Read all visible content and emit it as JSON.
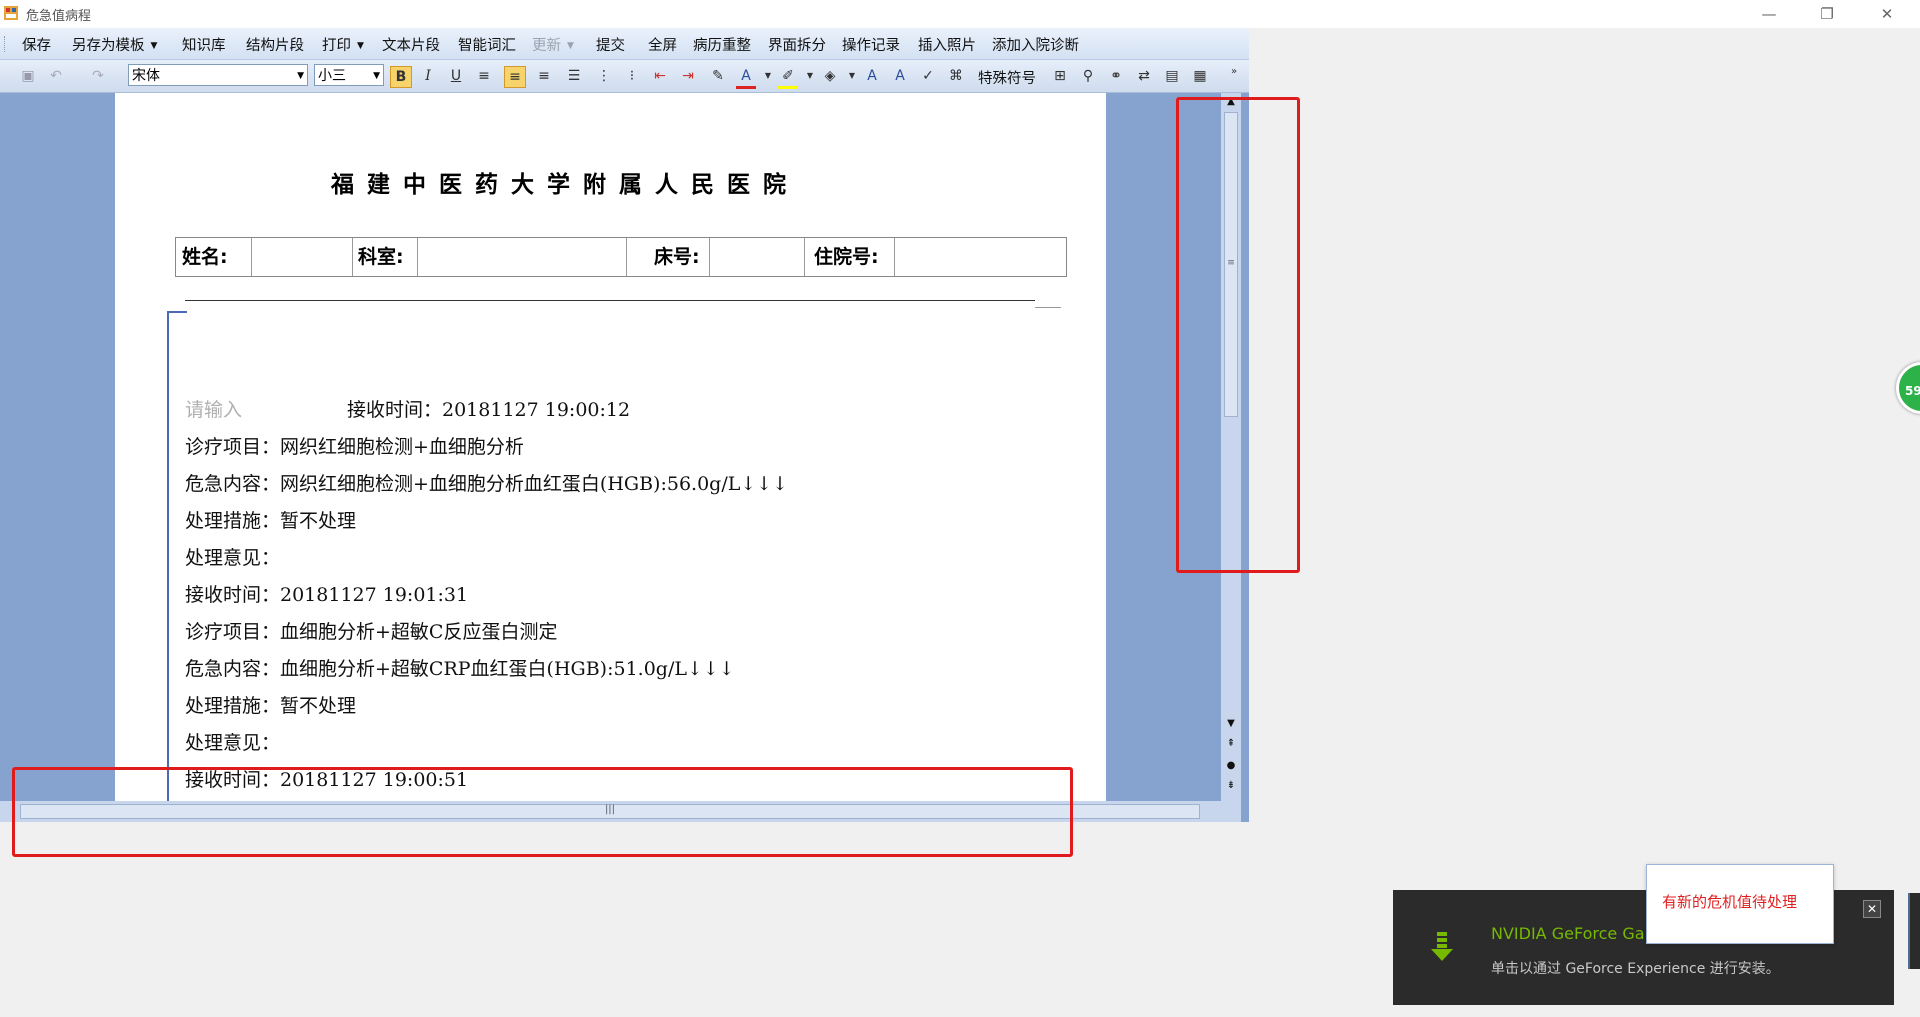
{
  "window": {
    "title": "危急值病程"
  },
  "menu": [
    {
      "label": "保存",
      "disabled": false
    },
    {
      "label": "另存为模板",
      "dropdown": true
    },
    {
      "label": "知识库"
    },
    {
      "label": "结构片段"
    },
    {
      "label": "打印",
      "dropdown": true
    },
    {
      "label": "文本片段"
    },
    {
      "label": "智能词汇"
    },
    {
      "label": "更新",
      "dropdown": true,
      "disabled": true
    },
    {
      "label": "提交"
    },
    {
      "label": "全屏"
    },
    {
      "label": "病历重整"
    },
    {
      "label": "界面拆分"
    },
    {
      "label": "操作记录"
    },
    {
      "label": "插入照片"
    },
    {
      "label": "添加入院诊断"
    }
  ],
  "toolbar": {
    "font_name": "宋体",
    "font_size": "小三",
    "special_symbol": "特殊符号",
    "bold": "B",
    "italic": "I",
    "underline": "U"
  },
  "document": {
    "hospital_name": "福建中医药大学附属人民医院",
    "header": {
      "name_label": "姓名:",
      "dept_label": "科室:",
      "bed_label": "床号:",
      "admission_label": "住院号:"
    },
    "placeholder": "请输入",
    "lines": [
      "接收时间：20181127 19:00:12",
      "诊疗项目：网织红细胞检测+血细胞分析",
      "危急内容：网织红细胞检测+血细胞分析血红蛋白(HGB):56.0g/L↓↓↓",
      "处理措施：暂不处理",
      "处理意见：",
      "接收时间：20181127 19:01:31",
      "诊疗项目：血细胞分析+超敏C反应蛋白测定",
      "危急内容：血细胞分析+超敏CRP血红蛋白(HGB):51.0g/L↓↓↓",
      "处理措施：暂不处理",
      "处理意见：",
      "接收时间：20181127 19:00:51"
    ]
  },
  "badge": {
    "value": "59"
  },
  "notification": {
    "title": "NVIDIA GeForce Ga",
    "body": "单击以通过 GeForce Experience 进行安装。"
  },
  "alert": {
    "text": "有新的危机值待处理"
  },
  "colors": {
    "frame": "#86a3cf",
    "highlight": "#e01b1b",
    "nvidia_green": "#76b900"
  }
}
